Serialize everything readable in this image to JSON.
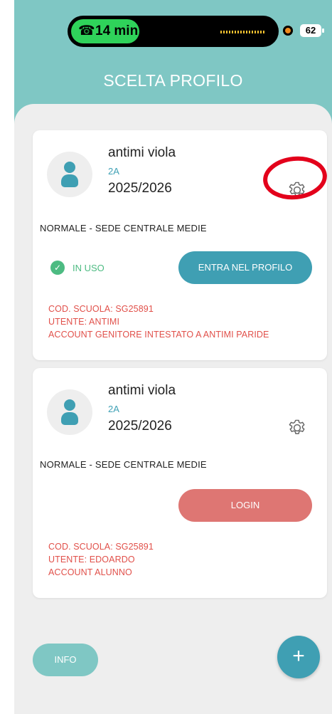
{
  "status_bar": {
    "call_time": "14 min",
    "battery": "62"
  },
  "header": {
    "title": "SCELTA PROFILO"
  },
  "profiles": [
    {
      "name": "antimi viola",
      "class": "2A",
      "year": "2025/2026",
      "sede": "NORMALE - SEDE CENTRALE MEDIE",
      "status": "IN USO",
      "action": "ENTRA NEL PROFILO",
      "school_code": "COD. SCUOLA: SG25891",
      "user": "UTENTE: ANTIMI",
      "account": "ACCOUNT GENITORE INTESTATO A ANTIMI PARIDE"
    },
    {
      "name": "antimi viola",
      "class": "2A",
      "year": "2025/2026",
      "sede": "NORMALE - SEDE CENTRALE MEDIE",
      "action": "LOGIN",
      "school_code": "COD. SCUOLA: SG25891",
      "user": "UTENTE: EDOARDO",
      "account": "ACCOUNT ALUNNO"
    }
  ],
  "footer": {
    "info_label": "INFO",
    "add_label": "+"
  },
  "colors": {
    "teal_header": "#7fc7c4",
    "primary_blue": "#3f9fb3",
    "login_red": "#de7673",
    "info_red": "#e1504a",
    "in_use_green": "#4dbb82",
    "annotation_red": "#e3001b"
  }
}
